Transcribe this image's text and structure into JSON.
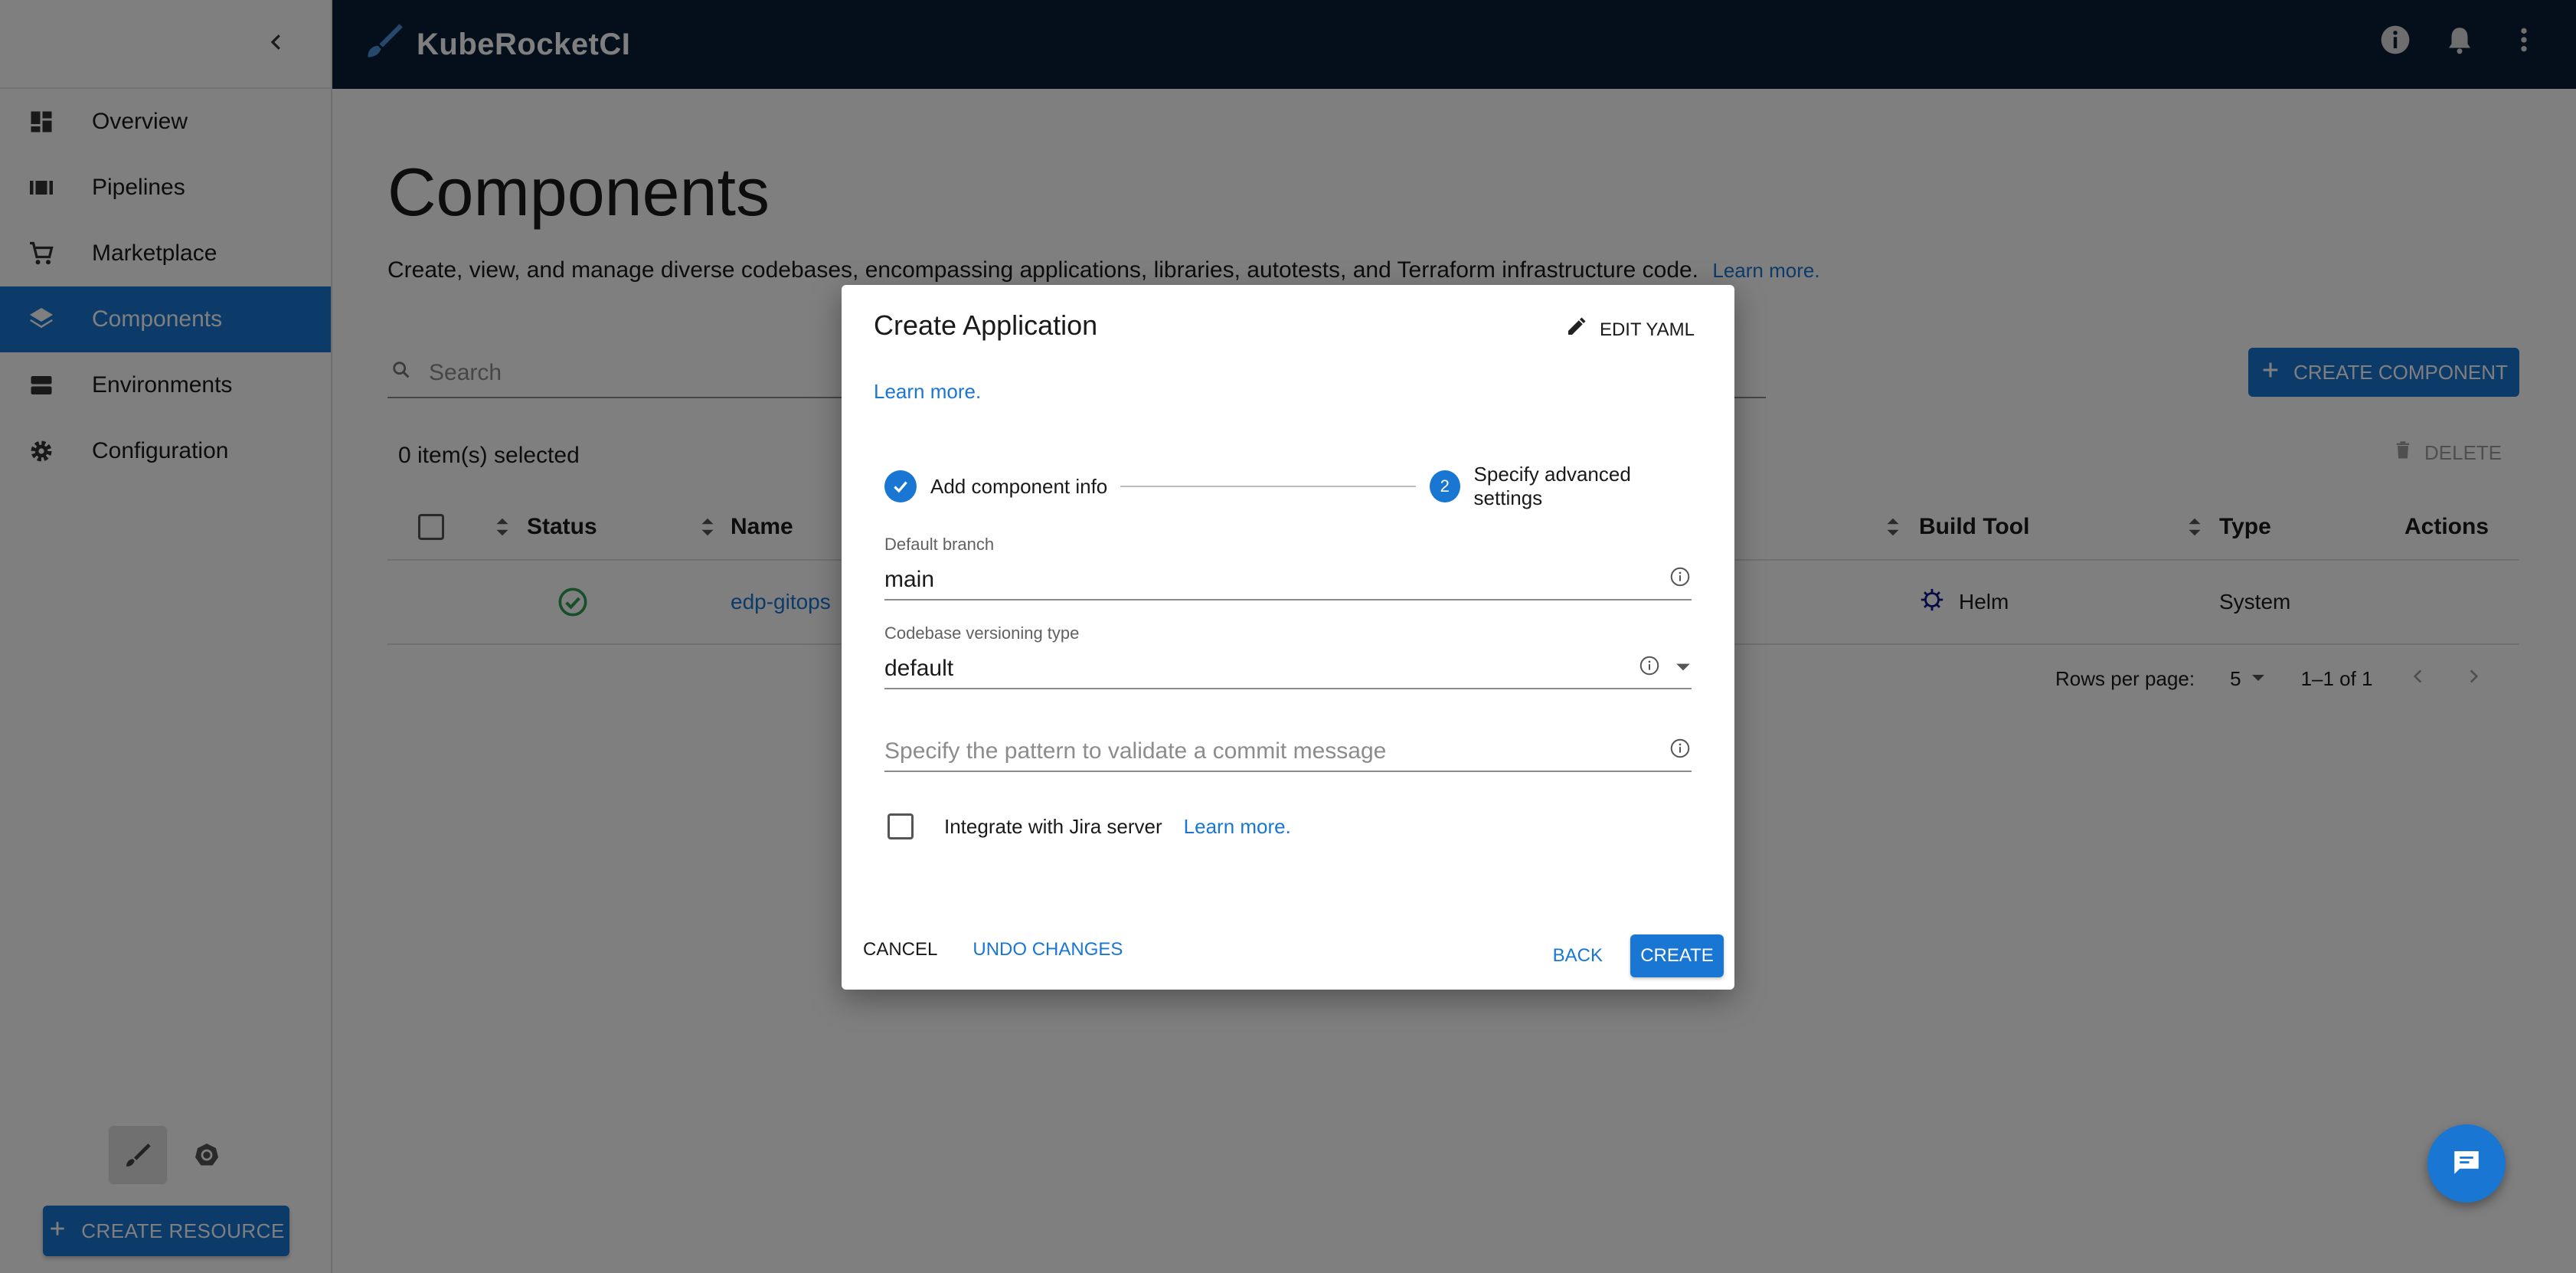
{
  "app": {
    "brand": "KubeRocketCI"
  },
  "sidebar": {
    "items": [
      {
        "label": "Overview",
        "icon": "dashboard-icon"
      },
      {
        "label": "Pipelines",
        "icon": "pipelines-icon"
      },
      {
        "label": "Marketplace",
        "icon": "cart-icon"
      },
      {
        "label": "Components",
        "icon": "layers-icon",
        "active": true
      },
      {
        "label": "Environments",
        "icon": "environments-icon"
      },
      {
        "label": "Configuration",
        "icon": "gear-icon"
      }
    ],
    "create_resource": "CREATE RESOURCE"
  },
  "main": {
    "title": "Components",
    "description": "Create, view, and manage diverse codebases, encompassing applications, libraries, autotests, and Terraform infrastructure code.",
    "learn_more": "Learn more.",
    "search_placeholder": "Search",
    "create_component": "CREATE COMPONENT",
    "selected_count": "0 item(s) selected",
    "delete": "DELETE",
    "table": {
      "headers": {
        "status": "Status",
        "name": "Name",
        "build_tool": "Build Tool",
        "type": "Type",
        "actions": "Actions"
      },
      "rows": [
        {
          "name": "edp-gitops",
          "build_tool": "Helm",
          "type": "System"
        }
      ]
    },
    "pagination": {
      "rows_per_page_label": "Rows per page:",
      "rows_per_page": "5",
      "range": "1–1 of 1"
    }
  },
  "dialog": {
    "title": "Create Application",
    "edit_yaml": "EDIT YAML",
    "learn_more": "Learn more.",
    "steps": [
      {
        "label": "Add component info",
        "state": "done"
      },
      {
        "number": "2",
        "label": "Specify advanced settings",
        "state": "active"
      }
    ],
    "fields": {
      "default_branch_label": "Default branch",
      "default_branch_value": "main",
      "versioning_label": "Codebase versioning type",
      "versioning_value": "default",
      "commit_pattern_placeholder": "Specify the pattern to validate a commit message"
    },
    "jira": {
      "label": "Integrate with Jira server",
      "learn_more": "Learn more."
    },
    "actions": {
      "cancel": "CANCEL",
      "undo": "UNDO CHANGES",
      "back": "BACK",
      "create": "CREATE"
    }
  },
  "colors": {
    "primary": "#1976d2",
    "header": "#0b1f36",
    "success": "#2e9e57"
  }
}
